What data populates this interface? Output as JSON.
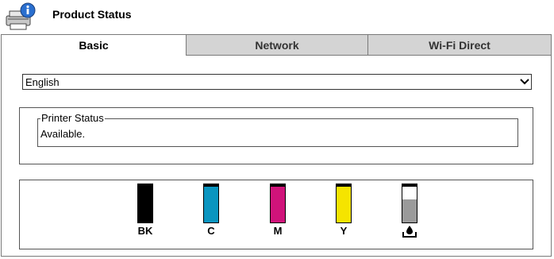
{
  "header": {
    "title": "Product Status",
    "icon": "printer-info-icon"
  },
  "tabs": [
    {
      "label": "Basic",
      "active": true
    },
    {
      "label": "Network",
      "active": false
    },
    {
      "label": "Wi-Fi Direct",
      "active": false
    }
  ],
  "language": {
    "selected": "English"
  },
  "printer_status": {
    "legend": "Printer Status",
    "value": "Available."
  },
  "ink_levels": [
    {
      "label": "BK",
      "color": "#000000",
      "level": 0.95
    },
    {
      "label": "C",
      "color": "#0a95c0",
      "level": 0.95
    },
    {
      "label": "M",
      "color": "#d0137a",
      "level": 0.95
    },
    {
      "label": "Y",
      "color": "#f5e400",
      "level": 0.95
    },
    {
      "label": "",
      "color": "#9a9a9a",
      "level": 0.6,
      "icon": "maintenance-box-icon"
    }
  ]
}
